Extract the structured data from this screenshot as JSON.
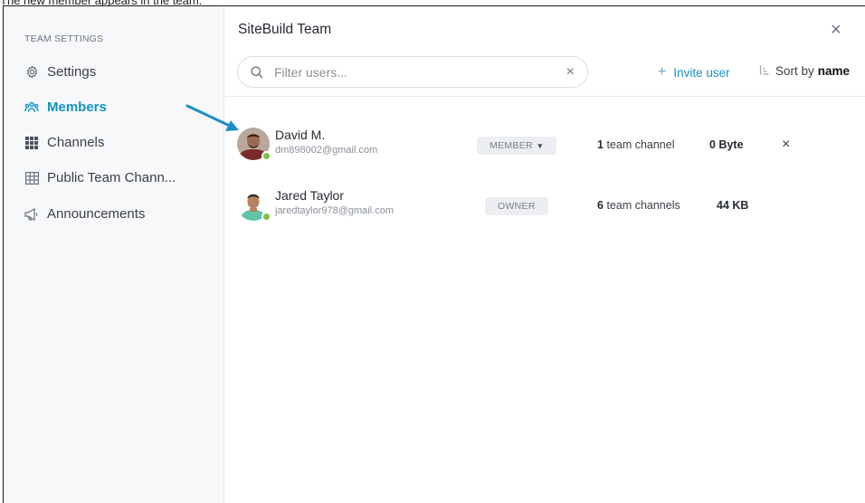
{
  "caption": "The new member appears in the team.",
  "sidebar": {
    "heading": "TEAM SETTINGS",
    "items": [
      {
        "label": "Settings",
        "icon": "gear-icon",
        "active": false
      },
      {
        "label": "Members",
        "icon": "members-icon",
        "active": true
      },
      {
        "label": "Channels",
        "icon": "grid-icon",
        "active": false
      },
      {
        "label": "Public Team Chann...",
        "icon": "table-icon",
        "active": false
      },
      {
        "label": "Announcements",
        "icon": "megaphone-icon",
        "active": false
      }
    ]
  },
  "main": {
    "title": "SiteBuild Team",
    "filter": {
      "placeholder": "Filter users...",
      "value": ""
    },
    "invite_label": "Invite user",
    "sort_prefix": "Sort by",
    "sort_field": "name",
    "members": [
      {
        "name": "David M.",
        "email": "dm898002@gmail.com",
        "role": "MEMBER",
        "channel_count": "1",
        "channel_label": "team channel",
        "storage": "0 Byte",
        "removable": true
      },
      {
        "name": "Jared Taylor",
        "email": "jaredtaylor978@gmail.com",
        "role": "OWNER",
        "channel_count": "6",
        "channel_label": "team channels",
        "storage": "44 KB",
        "removable": false
      }
    ]
  },
  "colors": {
    "accent": "#1493c4",
    "online": "#7cc142",
    "arrow": "#1b8fc2"
  }
}
